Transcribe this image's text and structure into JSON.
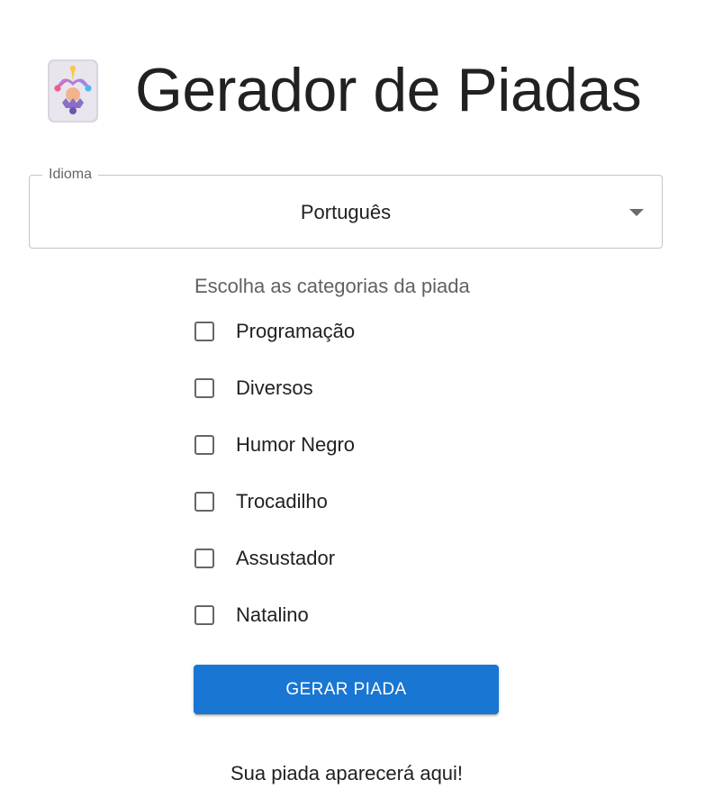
{
  "app": {
    "title": "Gerador de Piadas",
    "logo_icon": "jester-icon"
  },
  "language_select": {
    "label": "Idioma",
    "value": "Português"
  },
  "categories": {
    "heading": "Escolha as categorias da piada",
    "items": [
      {
        "label": "Programação",
        "checked": false
      },
      {
        "label": "Diversos",
        "checked": false
      },
      {
        "label": "Humor Negro",
        "checked": false
      },
      {
        "label": "Trocadilho",
        "checked": false
      },
      {
        "label": "Assustador",
        "checked": false
      },
      {
        "label": "Natalino",
        "checked": false
      }
    ]
  },
  "actions": {
    "generate_label": "GERAR PIADA"
  },
  "output": {
    "placeholder": "Sua piada aparecerá aqui!"
  },
  "colors": {
    "primary": "#1976d2",
    "text": "#212121",
    "secondary_text": "#616161",
    "border": "#c4c4c4"
  }
}
